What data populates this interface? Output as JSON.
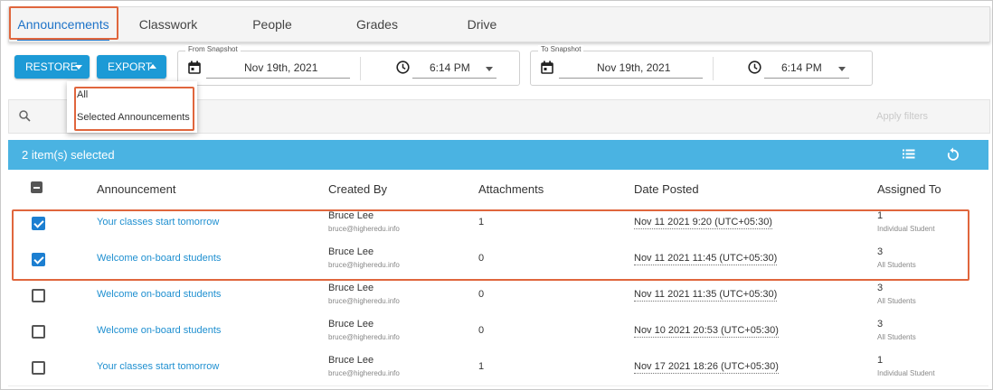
{
  "tabs": [
    {
      "label": "Announcements"
    },
    {
      "label": "Classwork"
    },
    {
      "label": "People"
    },
    {
      "label": "Grades"
    },
    {
      "label": "Drive"
    }
  ],
  "toolbar": {
    "restore_label": "RESTORE",
    "export_label": "EXPORT"
  },
  "from_snapshot": {
    "legend": "From Snapshot",
    "date": "Nov 19th, 2021",
    "time": "6:14 PM"
  },
  "to_snapshot": {
    "legend": "To Snapshot",
    "date": "Nov 19th, 2021",
    "time": "6:14 PM"
  },
  "export_menu": {
    "items": [
      {
        "label": "All"
      },
      {
        "label": "Selected Announcements"
      }
    ]
  },
  "filter": {
    "apply_label": "Apply filters"
  },
  "selection": {
    "text": "2 item(s) selected"
  },
  "table": {
    "headers": {
      "announcement": "Announcement",
      "created_by": "Created By",
      "attachments": "Attachments",
      "date_posted": "Date Posted",
      "assigned_to": "Assigned To"
    },
    "rows": [
      {
        "checked": true,
        "title": "Your classes start tomorrow",
        "author": "Bruce Lee",
        "email": "bruce@higheredu.info",
        "attachments": "1",
        "date": "Nov 11 2021 9:20 (UTC+05:30)",
        "assigned_count": "1",
        "assigned_label": "Individual Student"
      },
      {
        "checked": true,
        "title": "Welcome on-board students",
        "author": "Bruce Lee",
        "email": "bruce@higheredu.info",
        "attachments": "0",
        "date": "Nov 11 2021 11:45 (UTC+05:30)",
        "assigned_count": "3",
        "assigned_label": "All Students"
      },
      {
        "checked": false,
        "title": "Welcome on-board students",
        "author": "Bruce Lee",
        "email": "bruce@higheredu.info",
        "attachments": "0",
        "date": "Nov 11 2021 11:35 (UTC+05:30)",
        "assigned_count": "3",
        "assigned_label": "All Students"
      },
      {
        "checked": false,
        "title": "Welcome on-board students",
        "author": "Bruce Lee",
        "email": "bruce@higheredu.info",
        "attachments": "0",
        "date": "Nov 10 2021 20:53 (UTC+05:30)",
        "assigned_count": "3",
        "assigned_label": "All Students"
      },
      {
        "checked": false,
        "title": "Your classes start tomorrow",
        "author": "Bruce Lee",
        "email": "bruce@higheredu.info",
        "attachments": "1",
        "date": "Nov 17 2021 18:26 (UTC+05:30)",
        "assigned_count": "1",
        "assigned_label": "Individual Student"
      }
    ]
  },
  "colors": {
    "accent": "#1c9ad6",
    "selection_bar": "#4ab3e2",
    "highlight": "#e0663d",
    "link": "#1e8fd0"
  },
  "icons": {
    "calendar": "calendar-icon",
    "clock": "clock-icon",
    "search": "search-icon",
    "list": "list-icon",
    "refresh": "refresh-icon"
  }
}
